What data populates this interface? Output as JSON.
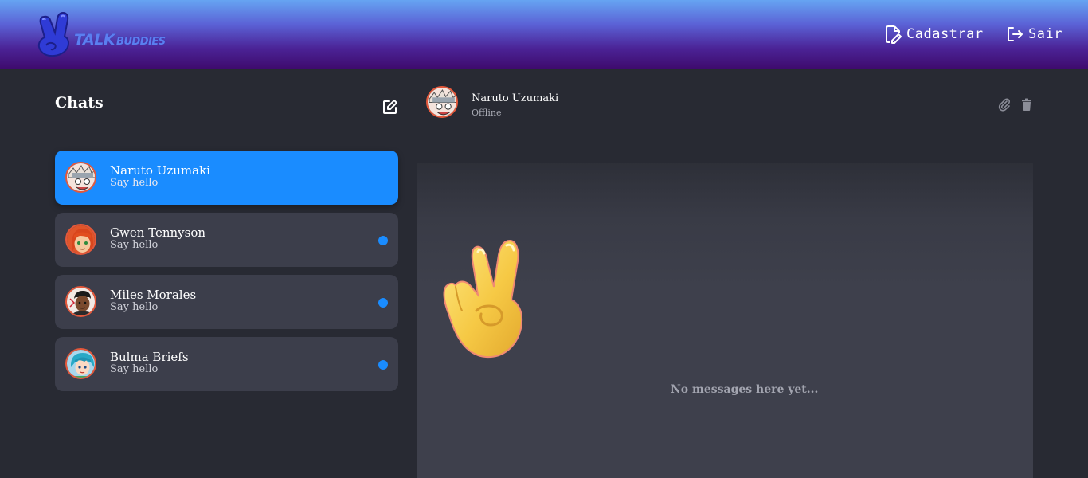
{
  "header": {
    "logo": {
      "word1": "TALK",
      "word2": "BUDDIES"
    },
    "register_label": "Cadastrar",
    "logout_label": "Sair"
  },
  "sidebar": {
    "title": "Chats",
    "chats": [
      {
        "name": "Naruto Uzumaki",
        "preview": "Say hello",
        "active": true,
        "unread": false
      },
      {
        "name": "Gwen Tennyson",
        "preview": "Say hello",
        "active": false,
        "unread": true
      },
      {
        "name": "Miles Morales",
        "preview": "Say hello",
        "active": false,
        "unread": true
      },
      {
        "name": "Bulma Briefs",
        "preview": "Say hello",
        "active": false,
        "unread": true
      }
    ]
  },
  "conversation": {
    "name": "Naruto Uzumaki",
    "status": "Offline",
    "empty_message": "No messages here yet..."
  },
  "colors": {
    "accent": "#1a8cff",
    "background": "#282a33",
    "card": "#3c3e4b",
    "avatar_ring": "#e4583b"
  },
  "icons": {
    "register": "file-edit-icon",
    "logout": "logout-icon",
    "new_chat": "edit-square-icon",
    "attach": "paperclip-icon",
    "delete": "trash-icon"
  }
}
